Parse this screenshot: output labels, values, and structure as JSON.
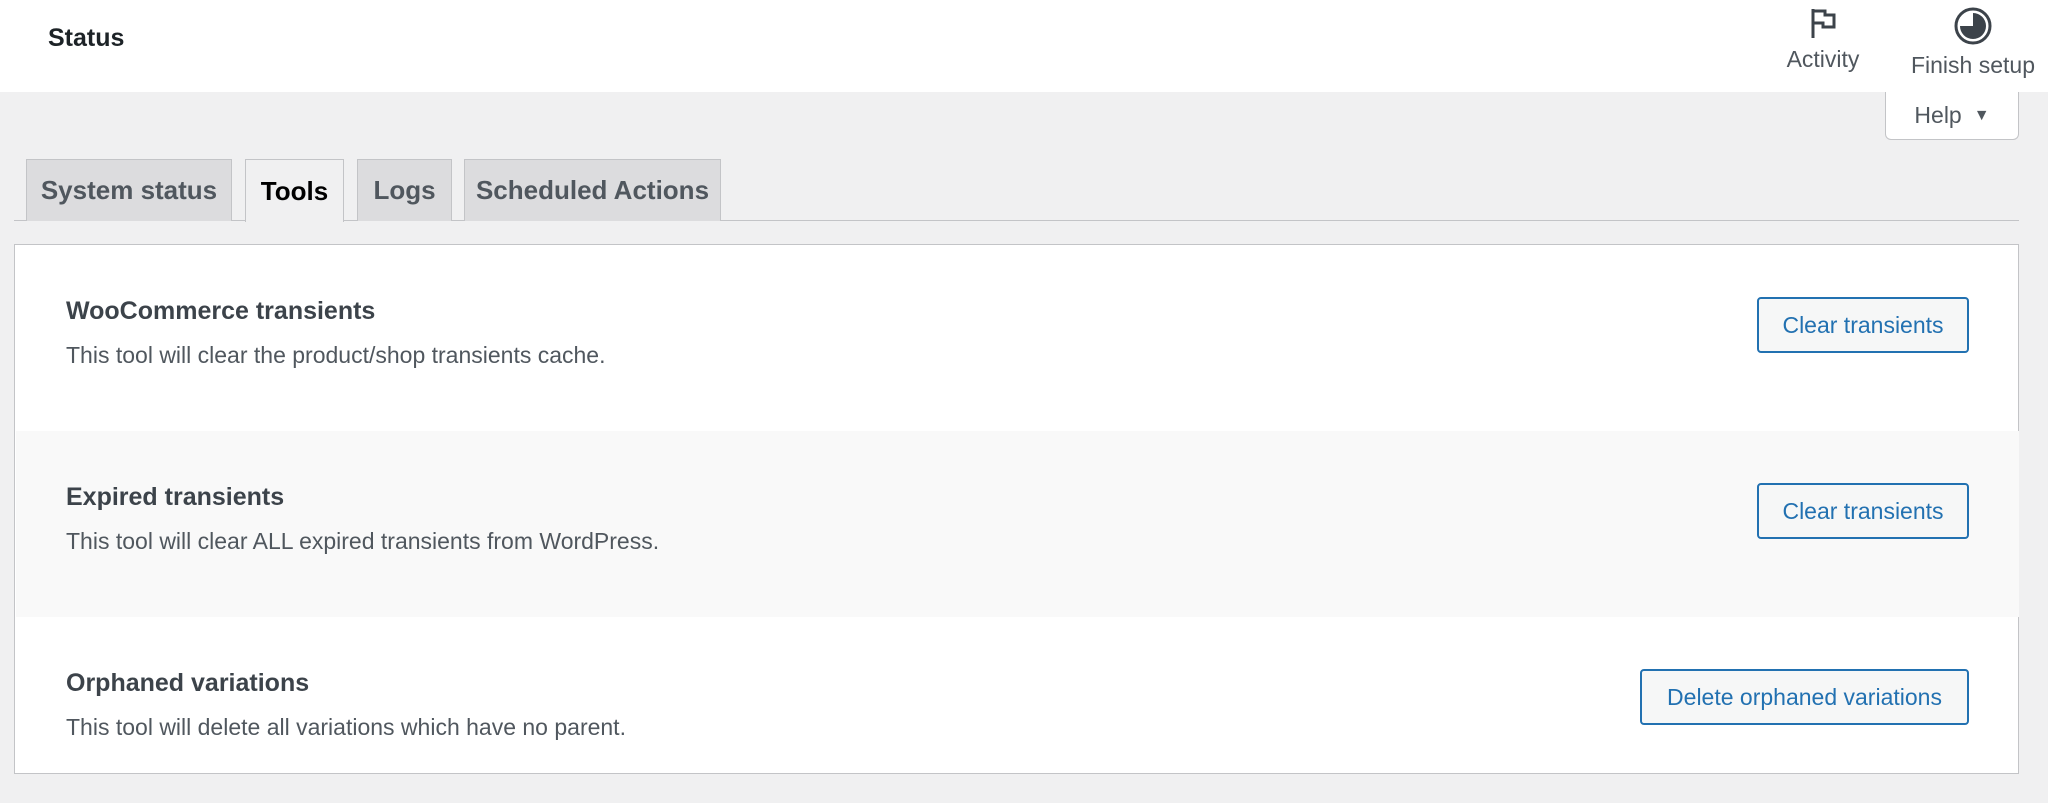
{
  "header": {
    "title": "Status",
    "activity_label": "Activity",
    "finish_setup_label": "Finish setup",
    "activity_icon": "flag-icon",
    "finish_setup_icon": "progress-pie-icon"
  },
  "help": {
    "label": "Help",
    "caret": "▼"
  },
  "tabs": [
    {
      "label": "System status",
      "active": false
    },
    {
      "label": "Tools",
      "active": true
    },
    {
      "label": "Logs",
      "active": false
    },
    {
      "label": "Scheduled Actions",
      "active": false
    }
  ],
  "tools": [
    {
      "title": "WooCommerce transients",
      "description": "This tool will clear the product/shop transients cache.",
      "button": "Clear transients"
    },
    {
      "title": "Expired transients",
      "description": "This tool will clear ALL expired transients from WordPress.",
      "button": "Clear transients"
    },
    {
      "title": "Orphaned variations",
      "description": "This tool will delete all variations which have no parent.",
      "button": "Delete orphaned variations"
    }
  ],
  "colors": {
    "accent": "#2271b1",
    "background": "#f0f0f1",
    "panel": "#ffffff"
  }
}
